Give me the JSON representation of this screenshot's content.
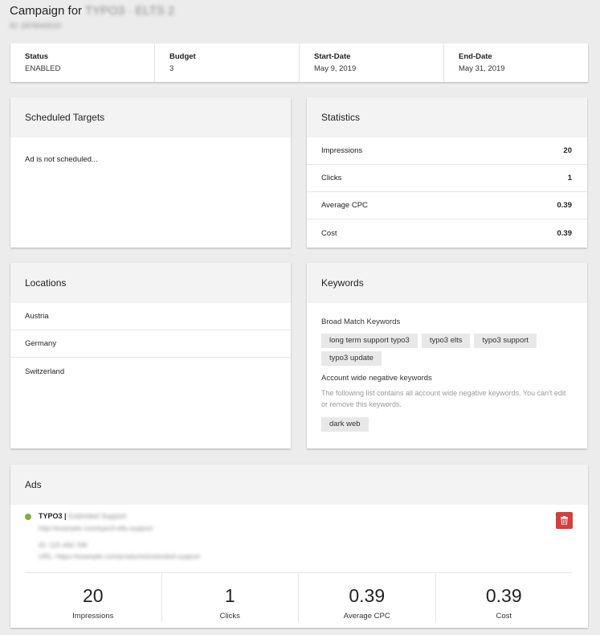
{
  "header": {
    "title_prefix": "Campaign for",
    "title_redacted": "TYPO3 · ELTS 2",
    "subtitle_redacted": "ID: 1876543210"
  },
  "summary": [
    {
      "label": "Status",
      "value": "ENABLED"
    },
    {
      "label": "Budget",
      "value": "3"
    },
    {
      "label": "Start-Date",
      "value": "May 9, 2019"
    },
    {
      "label": "End-Date",
      "value": "May 31, 2019"
    }
  ],
  "scheduled": {
    "title": "Scheduled Targets",
    "message": "Ad is not scheduled..."
  },
  "statistics": {
    "title": "Statistics",
    "rows": [
      {
        "label": "Impressions",
        "value": "20"
      },
      {
        "label": "Clicks",
        "value": "1"
      },
      {
        "label": "Average CPC",
        "value": "0.39"
      },
      {
        "label": "Cost",
        "value": "0.39"
      }
    ]
  },
  "locations": {
    "title": "Locations",
    "items": [
      "Austria",
      "Germany",
      "Switzerland"
    ]
  },
  "keywords": {
    "title": "Keywords",
    "broad_title": "Broad Match Keywords",
    "broad": [
      "long term support typo3",
      "typo3 elts",
      "typo3 support",
      "typo3 update"
    ],
    "negative_title": "Account wide negative keywords",
    "negative_note": "The following list contains all account wide negative keywords. You can't edit or remove this keywords.",
    "negative": [
      "dark web"
    ]
  },
  "ads": {
    "title": "Ads",
    "status_color": "#7fae3f",
    "ad_title": "TYPO3 |",
    "ad_title_redacted": "Extended Support",
    "ad_url_redacted": "http://example.com/typo3-elts-support",
    "ad_line1_redacted": "ID: 123 456 789",
    "ad_line2_redacted": "URL: https://example.com/products/extended-support",
    "delete_icon": "trash-icon",
    "stats": [
      {
        "value": "20",
        "label": "Impressions"
      },
      {
        "value": "1",
        "label": "Clicks"
      },
      {
        "value": "0.39",
        "label": "Average CPC"
      },
      {
        "value": "0.39",
        "label": "Cost"
      }
    ]
  }
}
